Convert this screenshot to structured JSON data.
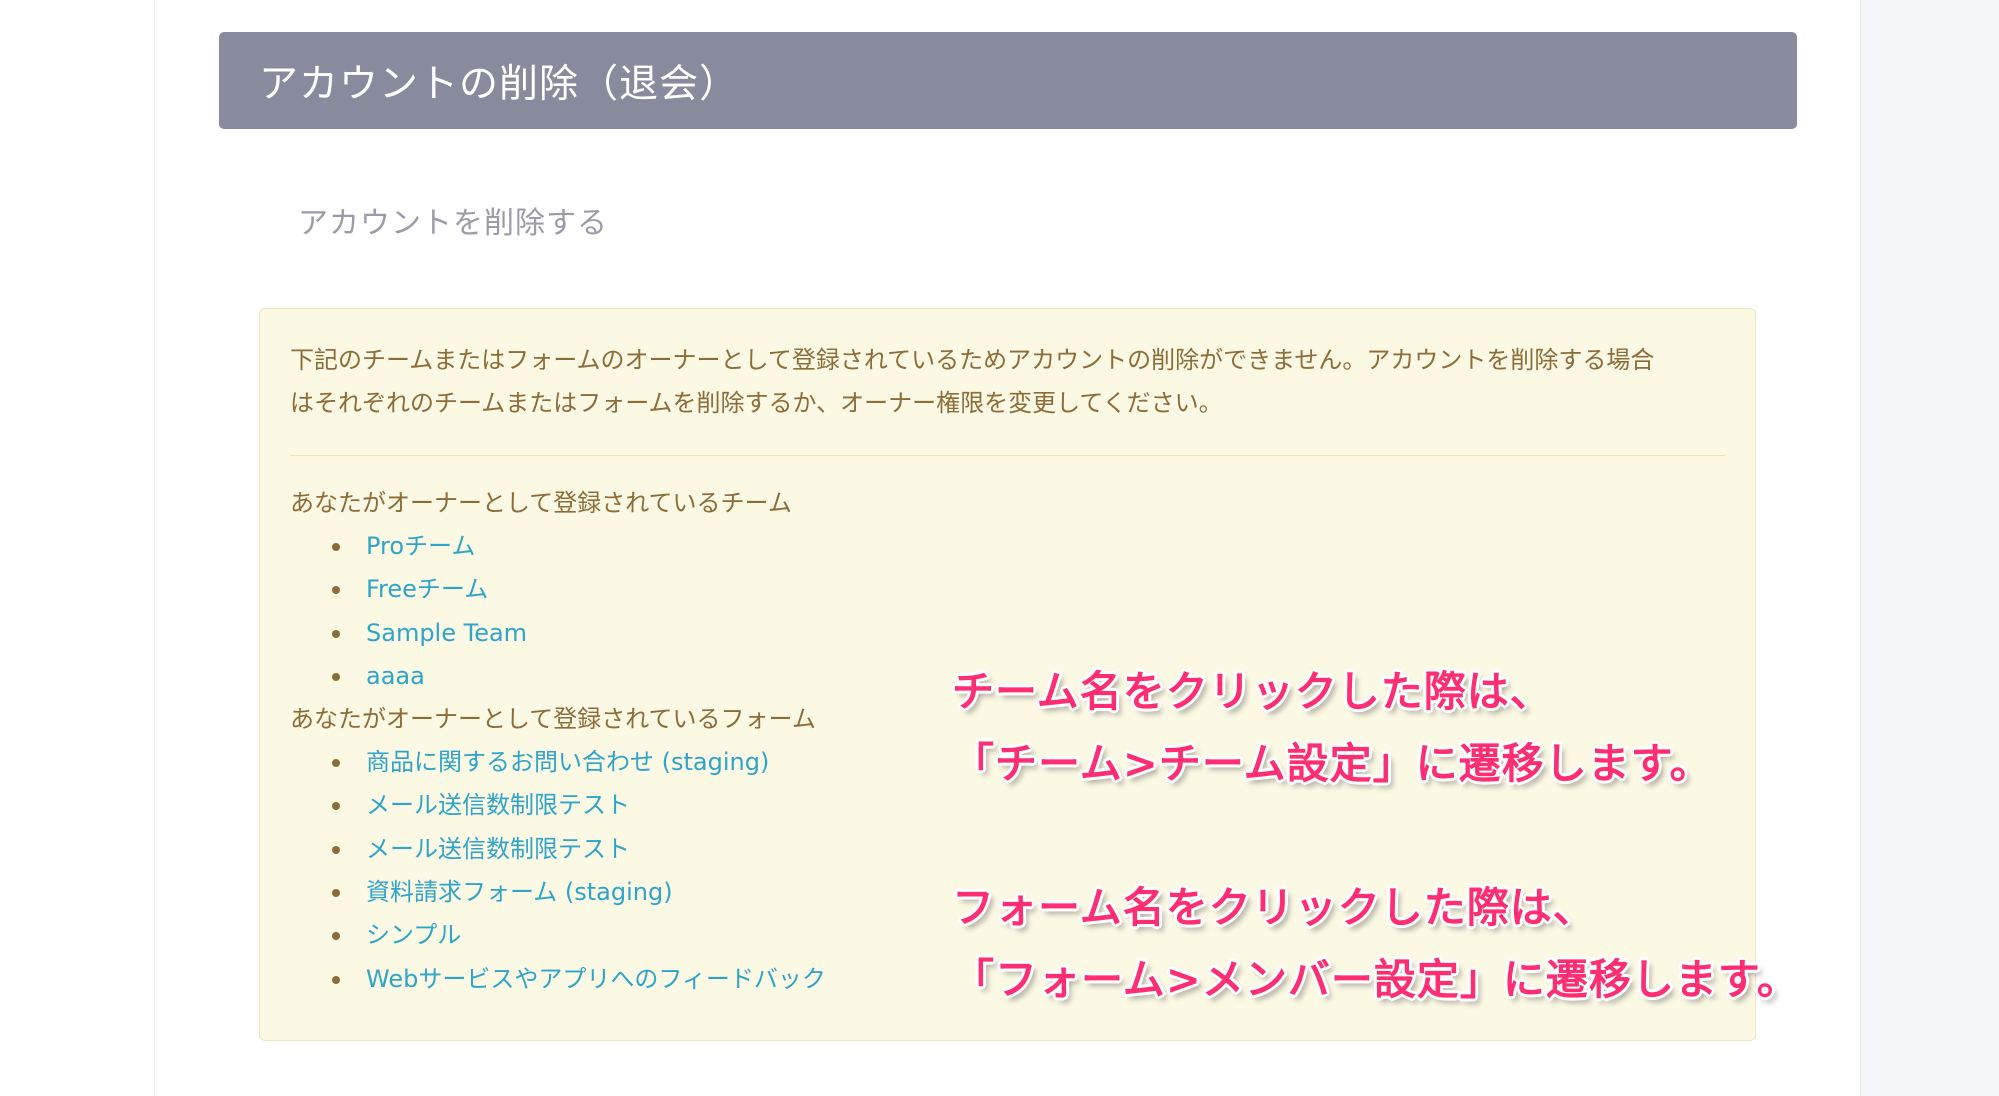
{
  "header": {
    "title": "アカウントの削除（退会）"
  },
  "section": {
    "title": "アカウントを削除する"
  },
  "warning": {
    "message": "下記のチームまたはフォームのオーナーとして登録されているためアカウントの削除ができません。アカウントを削除する場合\nはそれぞれのチームまたはフォームを削除するか、オーナー権限を変更してください。",
    "teams_heading": "あなたがオーナーとして登録されているチーム",
    "teams": [
      {
        "label": "Proチーム"
      },
      {
        "label": "Freeチーム"
      },
      {
        "label": "Sample Team"
      },
      {
        "label": "aaaa"
      }
    ],
    "forms_heading": "あなたがオーナーとして登録されているフォーム",
    "forms": [
      {
        "label": "商品に関するお問い合わせ (staging)"
      },
      {
        "label": "メール送信数制限テスト"
      },
      {
        "label": "メール送信数制限テスト"
      },
      {
        "label": "資料請求フォーム (staging)"
      },
      {
        "label": "シンプル"
      },
      {
        "label": "Webサービスやアプリへのフィードバック"
      }
    ]
  },
  "annotations": {
    "team_line1": "チーム名をクリックした際は、",
    "team_line2": "「チーム>チーム設定」に遷移します。",
    "form_line1": "フォーム名をクリックした際は、",
    "form_line2": "「フォーム>メンバー設定」に遷移します。"
  },
  "colors": {
    "header_bg": "#888a9e",
    "warning_bg": "#fbf8e4",
    "warning_text": "#8c6d3a",
    "link": "#2fa4c9",
    "annotation": "#ff2e73"
  }
}
